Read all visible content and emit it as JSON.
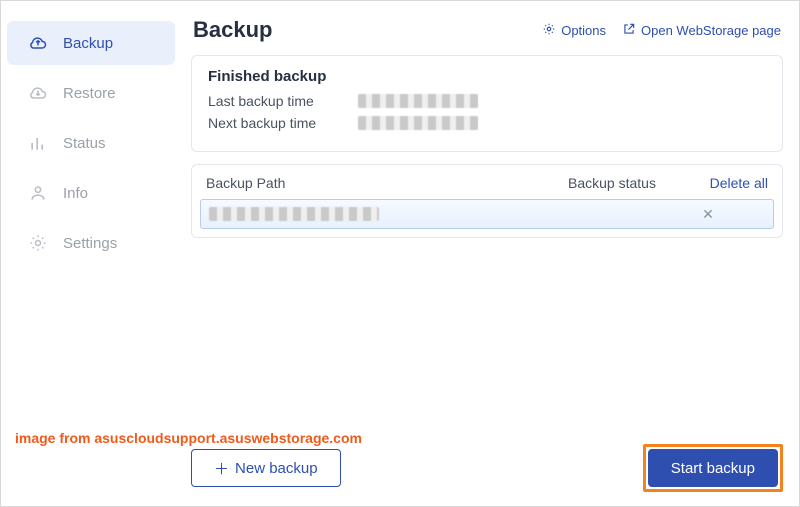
{
  "sidebar": {
    "items": [
      {
        "label": "Backup"
      },
      {
        "label": "Restore"
      },
      {
        "label": "Status"
      },
      {
        "label": "Info"
      },
      {
        "label": "Settings"
      }
    ]
  },
  "header": {
    "title": "Backup",
    "options_label": "Options",
    "external_label": "Open WebStorage page"
  },
  "finished_card": {
    "title": "Finished backup",
    "last_label": "Last backup time",
    "next_label": "Next backup time"
  },
  "table": {
    "col_path": "Backup Path",
    "col_status": "Backup status",
    "delete_all": "Delete all"
  },
  "footer": {
    "new_backup": "New  backup",
    "start_backup": "Start backup"
  },
  "attribution": "image from asuscloudsupport.asuswebstorage.com"
}
